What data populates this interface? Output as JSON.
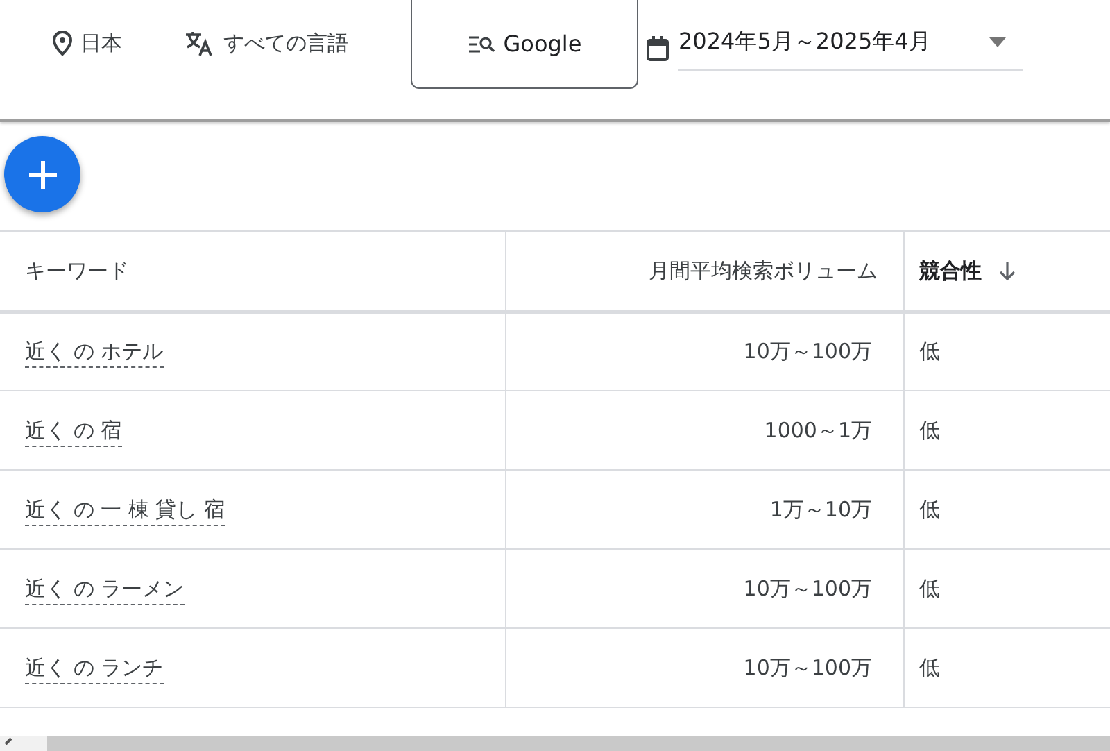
{
  "filters": {
    "location": "日本",
    "language": "すべての言語",
    "search_engine": "Google",
    "date_range": "2024年5月～2025年4月"
  },
  "table": {
    "columns": [
      {
        "label": "キーワード",
        "sorted": false
      },
      {
        "label": "月間平均検索ボリューム",
        "sorted": false
      },
      {
        "label": "競合性",
        "sorted": true
      }
    ],
    "rows": [
      {
        "keyword": "近く の ホテル",
        "volume": "10万～100万",
        "competition": "低"
      },
      {
        "keyword": "近く の 宿",
        "volume": "1000～1万",
        "competition": "低"
      },
      {
        "keyword": "近く の 一 棟 貸し 宿",
        "volume": "1万～10万",
        "competition": "低"
      },
      {
        "keyword": "近く の ラーメン",
        "volume": "10万～100万",
        "competition": "低"
      },
      {
        "keyword": "近く の ランチ",
        "volume": "10万～100万",
        "competition": "低"
      }
    ]
  }
}
